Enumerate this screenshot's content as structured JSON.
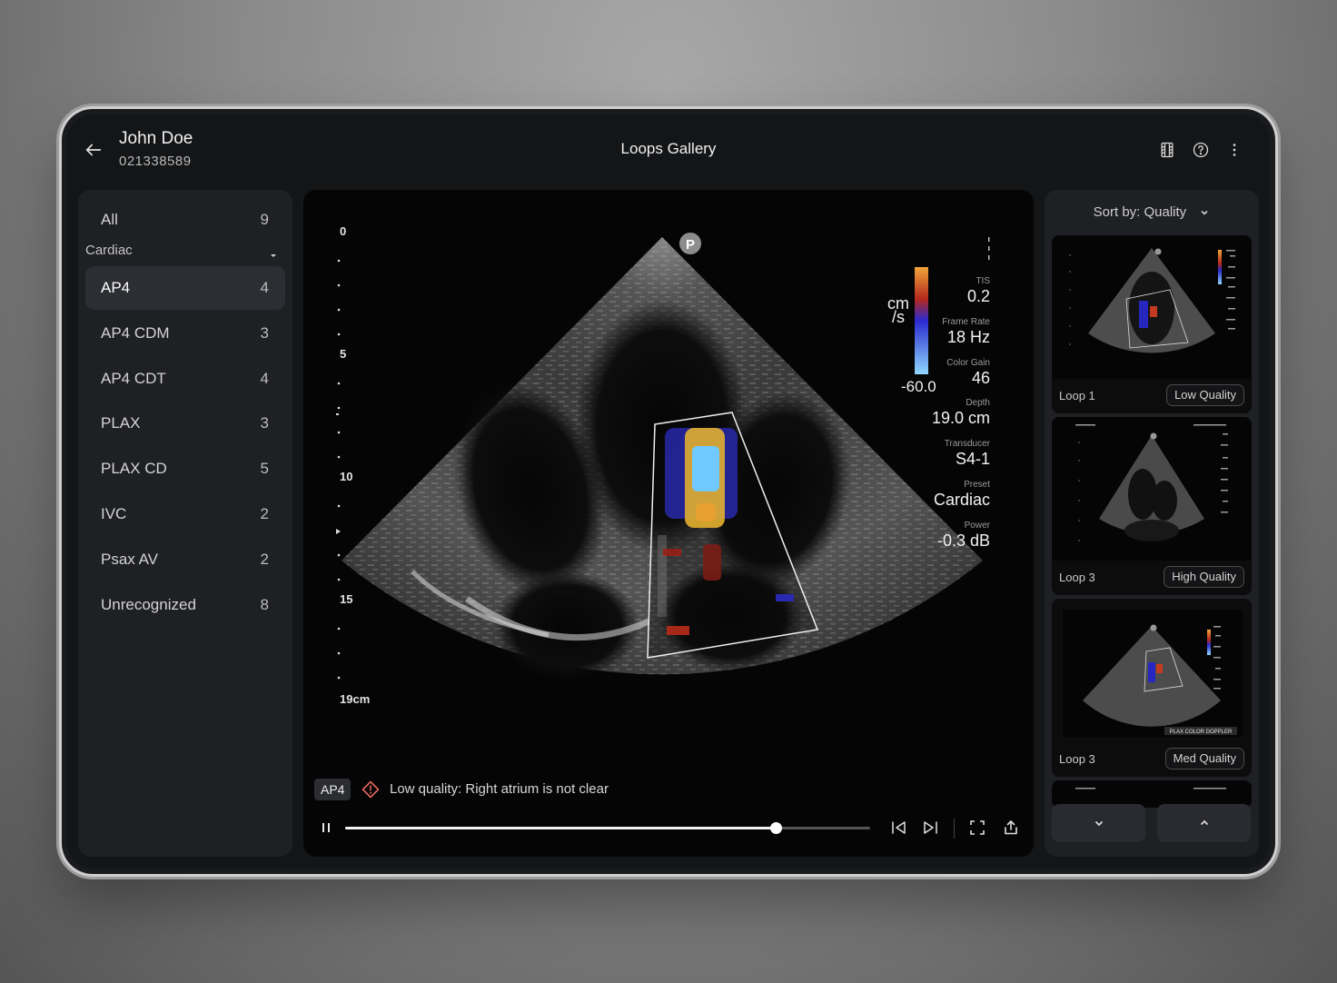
{
  "header": {
    "patient_name": "John Doe",
    "patient_id": "021338589",
    "title": "Loops Gallery",
    "icons": [
      "arrow-left-icon",
      "film-icon",
      "help-circle-icon",
      "more-vertical-icon"
    ]
  },
  "sidebar": {
    "all": {
      "label": "All",
      "count": "9"
    },
    "group": "Cardiac",
    "items": [
      {
        "label": "AP4",
        "count": "4",
        "active": true
      },
      {
        "label": "AP4 CDM",
        "count": "3"
      },
      {
        "label": "AP4 CDT",
        "count": "4"
      },
      {
        "label": "PLAX",
        "count": "3"
      },
      {
        "label": "PLAX CD",
        "count": "5"
      },
      {
        "label": "IVC",
        "count": "2"
      },
      {
        "label": "Psax AV",
        "count": "2"
      },
      {
        "label": "Unrecognized",
        "count": "8"
      }
    ]
  },
  "viewer": {
    "marker": "P",
    "depth_ticks": [
      "0",
      "5",
      "10",
      "15",
      "19cm"
    ],
    "color_scale": {
      "unit": "cm\n/s",
      "unit_top": "cm",
      "unit_bottom": "/s",
      "min": "-60.0"
    },
    "params": [
      {
        "label": "TIS",
        "value": "0.2"
      },
      {
        "label": "Frame Rate",
        "value": "18 Hz"
      },
      {
        "label": "Color Gain",
        "value": "46"
      },
      {
        "label": "Depth",
        "value": "19.0 cm"
      },
      {
        "label": "Transducer",
        "value": "S4-1"
      },
      {
        "label": "Preset",
        "value": "Cardiac"
      },
      {
        "label": "Power",
        "value": "-0.3 dB"
      }
    ],
    "view_badge": "AP4",
    "warning": "Low quality: Right atrium is not clear",
    "progress": 0.82,
    "colors": {
      "accent": "#ffffff",
      "warning": "#e0655b"
    }
  },
  "gallery": {
    "sort_label": "Sort by: Quality",
    "loops": [
      {
        "name": "Loop 1",
        "quality": "Low Quality"
      },
      {
        "name": "Loop 3",
        "quality": "High Quality"
      },
      {
        "name": "Loop 3",
        "quality": "Med Quality",
        "tag": "PLAX COLOR DOPPLER"
      }
    ]
  }
}
